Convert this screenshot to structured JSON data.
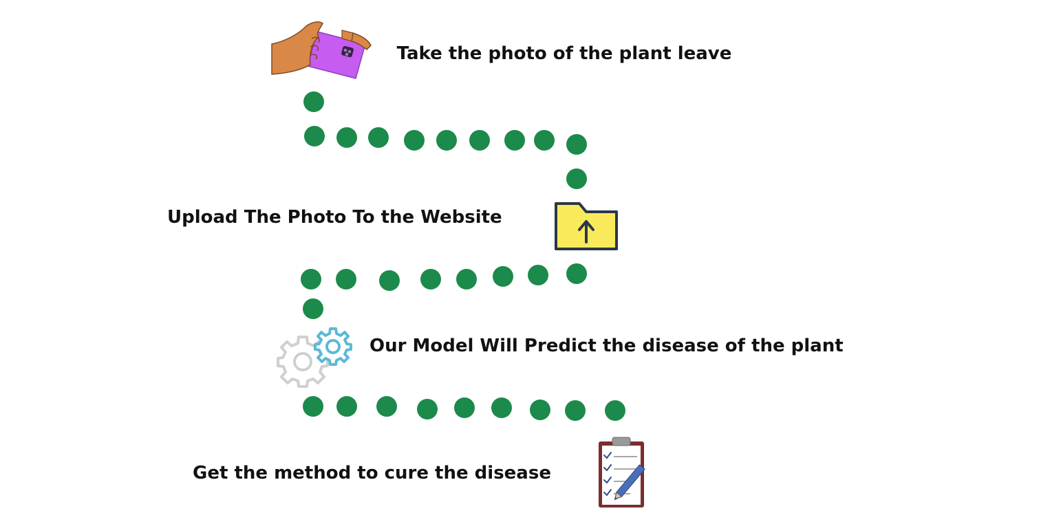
{
  "steps": [
    {
      "text": "Take the photo of the plant leave",
      "icon": "hand-holding-phone-icon"
    },
    {
      "text": "Upload The Photo To  the Website",
      "icon": "folder-upload-icon"
    },
    {
      "text": "Our Model Will Predict the disease of the plant",
      "icon": "gears-icon"
    },
    {
      "text": "Get the method to cure  the disease",
      "icon": "clipboard-checklist-icon"
    }
  ],
  "colors": {
    "path_dot": "#1b8a4a",
    "text": "#111111",
    "phone": "#c65cf0",
    "skin": "#d98848",
    "folder": "#f9ea5b",
    "folder_outline": "#2b3748",
    "gear_gray": "#cfcfcf",
    "gear_blue": "#5ab9d6",
    "clipboard": "#7a2e2e"
  }
}
